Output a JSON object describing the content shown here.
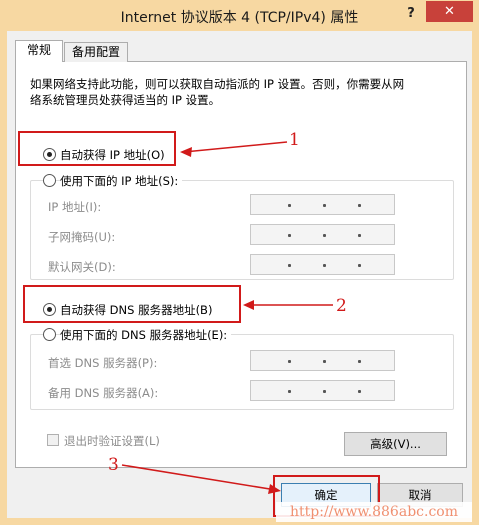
{
  "window": {
    "title": "Internet 协议版本 4 (TCP/IPv4) 属性",
    "help_label": "?",
    "close_label": "✕"
  },
  "tabs": [
    {
      "label": "常规",
      "selected": true
    },
    {
      "label": "备用配置",
      "selected": false
    }
  ],
  "description": {
    "line1": "如果网络支持此功能，则可以获取自动指派的 IP 设置。否则，你需要从网",
    "line2": "络系统管理员处获得适当的 IP 设置。"
  },
  "ip_section": {
    "auto_label": "自动获得 IP 地址(O)",
    "auto_selected": true,
    "manual_label": "使用下面的 IP 地址(S):",
    "fields": [
      {
        "label": "IP 地址(I):",
        "value": ""
      },
      {
        "label": "子网掩码(U):",
        "value": ""
      },
      {
        "label": "默认网关(D):",
        "value": ""
      }
    ]
  },
  "dns_section": {
    "auto_label": "自动获得 DNS 服务器地址(B)",
    "auto_selected": true,
    "manual_label": "使用下面的 DNS 服务器地址(E):",
    "fields": [
      {
        "label": "首选 DNS 服务器(P):",
        "value": ""
      },
      {
        "label": "备用 DNS 服务器(A):",
        "value": ""
      }
    ]
  },
  "validate_checkbox": {
    "label": "退出时验证设置(L)",
    "checked": false
  },
  "buttons": {
    "advanced": "高级(V)...",
    "ok": "确定",
    "cancel": "取消"
  },
  "annotations": {
    "n1": "1",
    "n2": "2",
    "n3": "3"
  },
  "watermark": "http://www.886abc.com",
  "colors": {
    "titlebar": "#f7d8a2",
    "close": "#c8413a",
    "annotation": "#d11a1a"
  }
}
